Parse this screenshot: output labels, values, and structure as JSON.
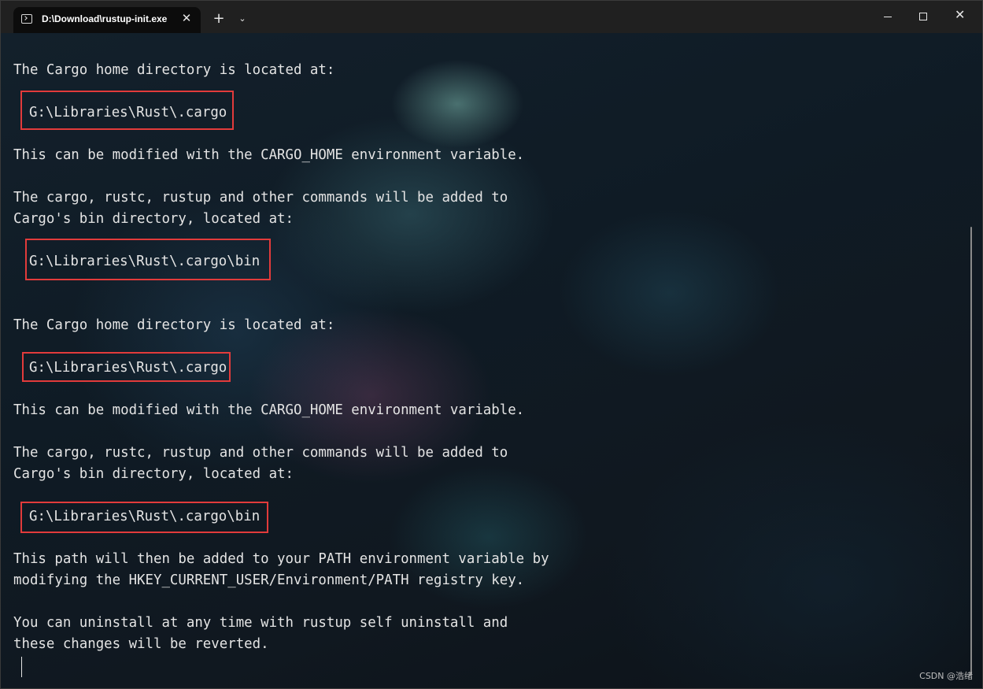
{
  "tab": {
    "title": "D:\\Download\\rustup-init.exe",
    "icon": "terminal-icon",
    "close_glyph": "✕"
  },
  "titlebar": {
    "new_tab_glyph": "+",
    "dropdown_glyph": "⌄",
    "close_glyph": "✕"
  },
  "terminal": {
    "lines": [
      "The Cargo home directory is located at:",
      "G:\\Libraries\\Rust\\.cargo",
      "This can be modified with the CARGO_HOME environment variable.",
      "The cargo, rustc, rustup and other commands will be added to",
      "Cargo's bin directory, located at:",
      "G:\\Libraries\\Rust\\.cargo\\bin",
      "The Cargo home directory is located at:",
      "G:\\Libraries\\Rust\\.cargo",
      "This can be modified with the CARGO_HOME environment variable.",
      "The cargo, rustc, rustup and other commands will be added to",
      "Cargo's bin directory, located at:",
      "G:\\Libraries\\Rust\\.cargo\\bin",
      "This path will then be added to your PATH environment variable by",
      "modifying the HKEY_CURRENT_USER/Environment/PATH registry key.",
      "You can uninstall at any time with rustup self uninstall and",
      "these changes will be reverted."
    ],
    "highlight_color": "#e23b3b"
  },
  "watermark": "CSDN @浩绪"
}
